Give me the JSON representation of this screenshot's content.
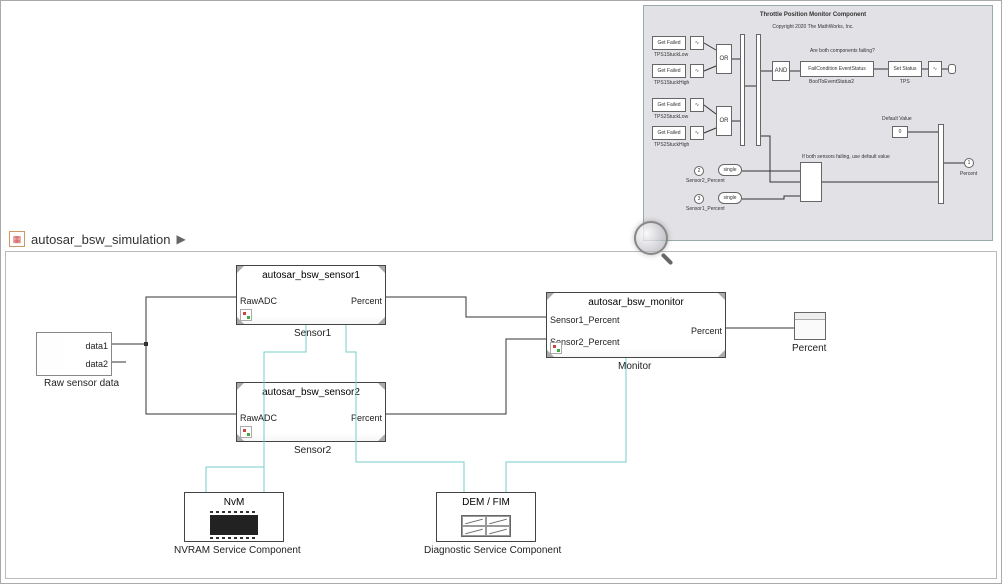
{
  "breadcrumb": {
    "model_name": "autosar_bsw_simulation"
  },
  "blocks": {
    "source": {
      "out1": "data1",
      "out2": "data2",
      "label": "Raw sensor data"
    },
    "sensor1": {
      "title": "autosar_bsw_sensor1",
      "in": "RawADC",
      "out": "Percent",
      "label": "Sensor1"
    },
    "sensor2": {
      "title": "autosar_bsw_sensor2",
      "in": "RawADC",
      "out": "Percent",
      "label": "Sensor2"
    },
    "monitor": {
      "title": "autosar_bsw_monitor",
      "in1": "Sensor1_Percent",
      "in2": "Sensor2_Percent",
      "out": "Percent",
      "label": "Monitor"
    },
    "scope": {
      "label": "Percent"
    },
    "nvm": {
      "title": "NvM",
      "label": "NVRAM Service Component"
    },
    "dem": {
      "title": "DEM / FIM",
      "label": "Diagnostic Service Component"
    }
  },
  "inset": {
    "title": "Throttle Position Monitor Component",
    "copyright": "Copyright 2020 The MathWorks, Inc.",
    "get_failed": "Get Failed",
    "tps1_low": "TPS1StuckLow",
    "tps1_high": "TPS1StuckHigh",
    "tps2_low": "TPS2StuckLow",
    "tps2_high": "TPS2StuckHigh",
    "or": "OR",
    "and": "AND",
    "fail_q": "Are both components failing?",
    "fail_cond": "FailCondition     EventStatus",
    "bool_evt": "BoolToEventStatus2",
    "set_status": "Set Status",
    "tps": "TPS",
    "default": "Default Value",
    "zero": "0",
    "if_fail": "If both sensors failing, use default value",
    "s2": "Sensor2_Percent",
    "s1": "Sensor1_Percent",
    "single": "single",
    "in2": "2",
    "in3": "3",
    "out1": "1",
    "out1_lbl": "Percent"
  }
}
